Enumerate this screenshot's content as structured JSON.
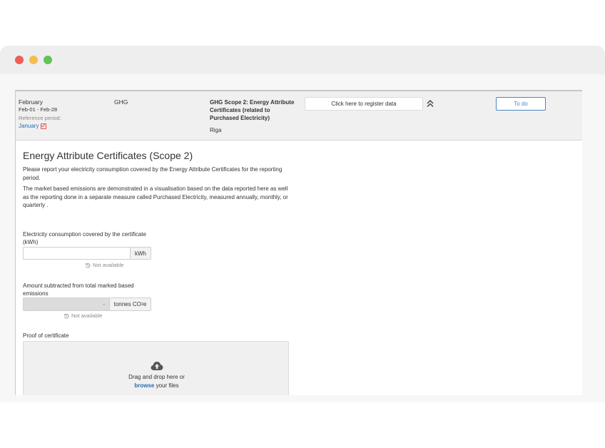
{
  "header": {
    "period_month": "February",
    "period_range": "Feb-01 - Feb-28",
    "reference_label": "Reference period:",
    "reference_value": "January",
    "category": "GHG",
    "scope_title": "GHG Scope 2: Energy Attribute Certificates (related to Purchased Electricity)",
    "location": "Riga",
    "register_button": "Click here to register data",
    "todo_button": "To do"
  },
  "form": {
    "title": "Energy Attribute Certificates (Scope 2)",
    "description_1": "Please report your electricity consumption covered by the Energy Attribute Certificates for the reporting period.",
    "description_2": "The market based emissions are demonstrated in a visualisation based on the data reported here as well as the reporting done in a separate measure called Purchased Electricity, measured annually, monthly, or quarterly .",
    "electricity": {
      "label": "Electricity consumption covered by the certificate (kWh)",
      "value": "",
      "unit": "kWh",
      "status": "Not available"
    },
    "subtracted": {
      "label": "Amount subtracted from total marked based emissions",
      "value": "-",
      "unit_prefix": "tonnes CO",
      "unit_sub": "2",
      "unit_suffix": "e",
      "status": "Not available"
    },
    "proof": {
      "label": "Proof of certificate",
      "drop_text": "Drag and drop here or",
      "browse_link": "browse",
      "browse_suffix": " your files"
    }
  },
  "colors": {
    "accent": "#2a6cb0",
    "todo": "#4a86c5",
    "check": "#e0534f"
  }
}
